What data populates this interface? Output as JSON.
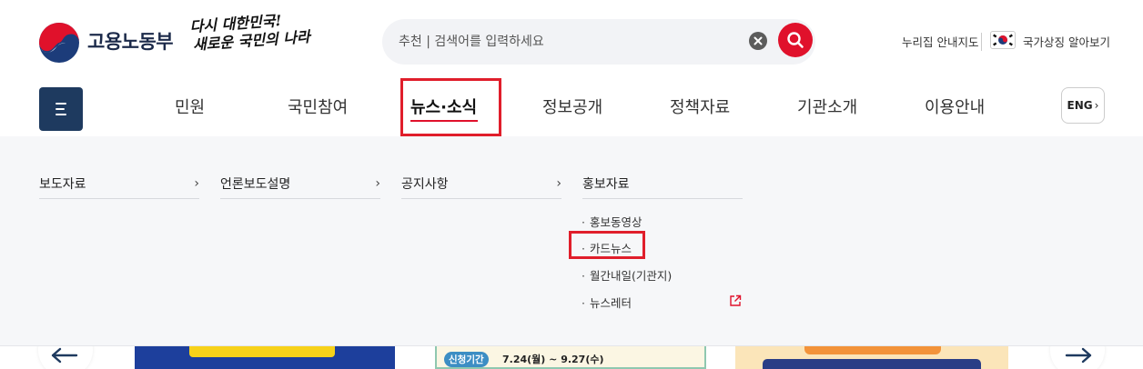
{
  "header": {
    "logo_text": "고용노동부",
    "slogan_line1": "다시 대한민국!",
    "slogan_line2": "새로운 국민의 나라"
  },
  "search": {
    "placeholder": "추천 | 검색어를 입력하세요"
  },
  "utility": {
    "sitemap": "누리집 안내지도",
    "national_symbols": "국가상징 알아보기"
  },
  "nav": {
    "items": [
      "민원",
      "국민참여",
      "뉴스·소식",
      "정보공개",
      "정책자료",
      "기관소개",
      "이용안내"
    ],
    "active_index": 2,
    "lang_button": "ENG"
  },
  "dropdown": {
    "columns": [
      {
        "title": "보도자료",
        "has_arrow": true
      },
      {
        "title": "언론보도설명",
        "has_arrow": true
      },
      {
        "title": "공지사항",
        "has_arrow": true
      },
      {
        "title": "홍보자료",
        "has_arrow": false
      }
    ],
    "promo_items": [
      "홍보동영상",
      "카드뉴스",
      "월간내일(기관지)",
      "뉴스레터"
    ]
  },
  "banners": {
    "banner2_badge": "신청기간",
    "banner2_dates": "7.24(월) ~ 9.27(수)"
  },
  "colors": {
    "brand_navy": "#1e3a5f",
    "accent_red": "#e0112b",
    "highlight_box": "#e01e2b",
    "panel_bg": "#f6f7f9"
  }
}
